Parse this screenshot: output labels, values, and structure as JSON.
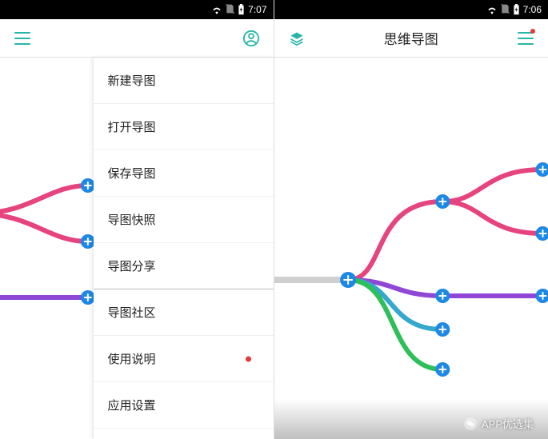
{
  "left": {
    "status_time": "7:07",
    "menu": [
      {
        "label": "新建导图",
        "sep": ""
      },
      {
        "label": "打开导图",
        "sep": ""
      },
      {
        "label": "保存导图",
        "sep": ""
      },
      {
        "label": "导图快照",
        "sep": ""
      },
      {
        "label": "导图分享",
        "sep": "thick"
      },
      {
        "label": "导图社区",
        "sep": ""
      },
      {
        "label": "使用说明",
        "sep": "",
        "dot": true
      },
      {
        "label": "应用设置",
        "sep": ""
      }
    ]
  },
  "right": {
    "status_time": "7:06",
    "title": "思维导图"
  },
  "colors": {
    "teal": "#26b6a6",
    "pink": "#e6447f",
    "purple": "#9147d6",
    "blue": "#33a7cc",
    "green": "#2fbf5a",
    "node": "#1e88e5",
    "gray": "#cfcfcf"
  },
  "watermark": "APP优选集"
}
